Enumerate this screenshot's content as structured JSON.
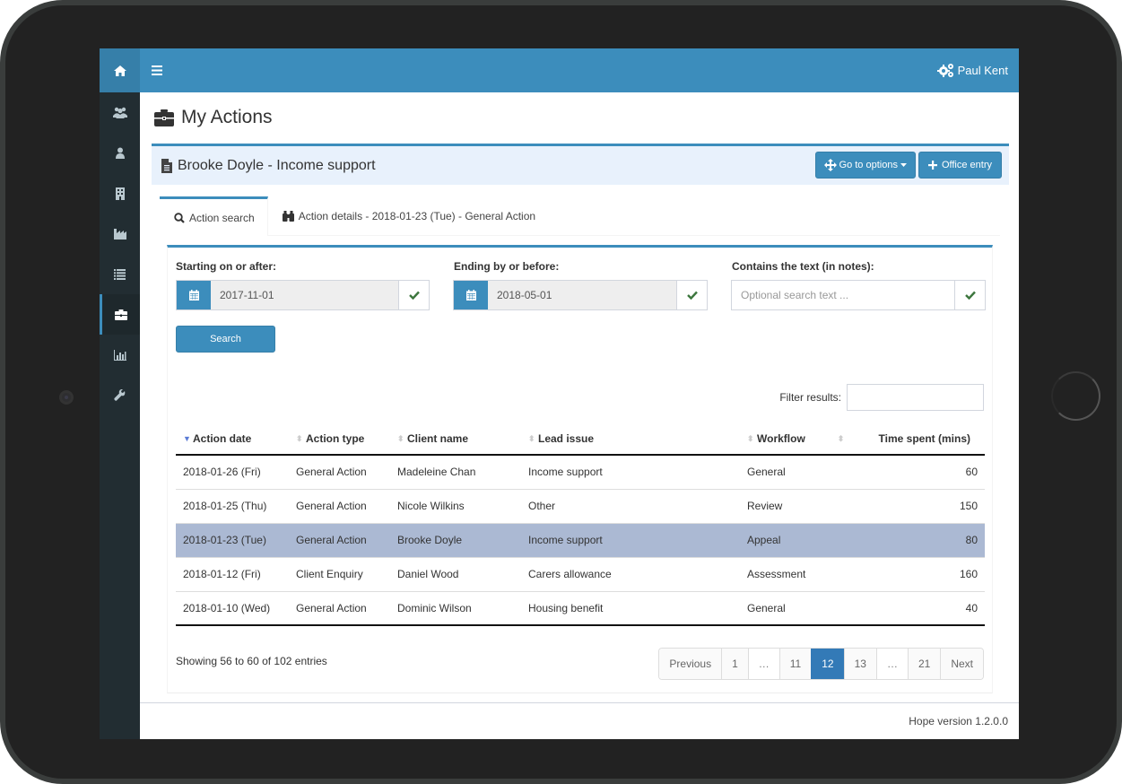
{
  "app": {
    "user_name": "Paul Kent",
    "version_text": "Hope version 1.2.0.0",
    "accent_color": "#3c8dbc"
  },
  "topbar": {
    "home_icon": "home-icon",
    "menu_icon": "hamburger-icon",
    "user_icon": "gears-icon"
  },
  "sidebar": {
    "items": [
      {
        "icon": "users-icon",
        "active": false
      },
      {
        "icon": "user-icon",
        "active": false
      },
      {
        "icon": "building-icon",
        "active": false
      },
      {
        "icon": "industry-icon",
        "active": false
      },
      {
        "icon": "list-icon",
        "active": false
      },
      {
        "icon": "briefcase-icon",
        "active": true
      },
      {
        "icon": "bar-chart-icon",
        "active": false
      },
      {
        "icon": "wrench-icon",
        "active": false
      }
    ]
  },
  "page": {
    "title": "My Actions"
  },
  "box": {
    "title": "Brooke Doyle - Income support",
    "go_to_options_label": "Go to options",
    "office_entry_label": "Office entry"
  },
  "tabs": [
    {
      "label": "Action search",
      "active": true
    },
    {
      "label": "Action details - 2018-01-23 (Tue) - General Action",
      "active": false
    }
  ],
  "search_form": {
    "start_label": "Starting on or after:",
    "start_value": "2017-11-01",
    "end_label": "Ending by or before:",
    "end_value": "2018-05-01",
    "text_label": "Contains the text (in notes):",
    "text_placeholder": "Optional search text ...",
    "text_value": "",
    "search_button": "Search"
  },
  "results": {
    "filter_label": "Filter results:",
    "filter_value": "",
    "columns": [
      "Action date",
      "Action type",
      "Client name",
      "Lead issue",
      "Workflow",
      "Time spent (mins)"
    ],
    "sort_column": "Action date",
    "sort_direction": "descending",
    "rows": [
      {
        "date": "2018-01-26 (Fri)",
        "type": "General Action",
        "client": "Madeleine Chan",
        "issue": "Income support",
        "workflow": "General",
        "time": "60",
        "selected": false
      },
      {
        "date": "2018-01-25 (Thu)",
        "type": "General Action",
        "client": "Nicole Wilkins",
        "issue": "Other",
        "workflow": "Review",
        "time": "150",
        "selected": false
      },
      {
        "date": "2018-01-23 (Tue)",
        "type": "General Action",
        "client": "Brooke Doyle",
        "issue": "Income support",
        "workflow": "Appeal",
        "time": "80",
        "selected": true
      },
      {
        "date": "2018-01-12 (Fri)",
        "type": "Client Enquiry",
        "client": "Daniel Wood",
        "issue": "Carers allowance",
        "workflow": "Assessment",
        "time": "160",
        "selected": false
      },
      {
        "date": "2018-01-10 (Wed)",
        "type": "General Action",
        "client": "Dominic Wilson",
        "issue": "Housing benefit",
        "workflow": "General",
        "time": "40",
        "selected": false
      }
    ],
    "info_text": "Showing 56 to 60 of 102 entries",
    "pagination": {
      "previous": "Previous",
      "pages": [
        "1",
        "…",
        "11",
        "12",
        "13",
        "…",
        "21"
      ],
      "current": "12",
      "next": "Next"
    }
  }
}
